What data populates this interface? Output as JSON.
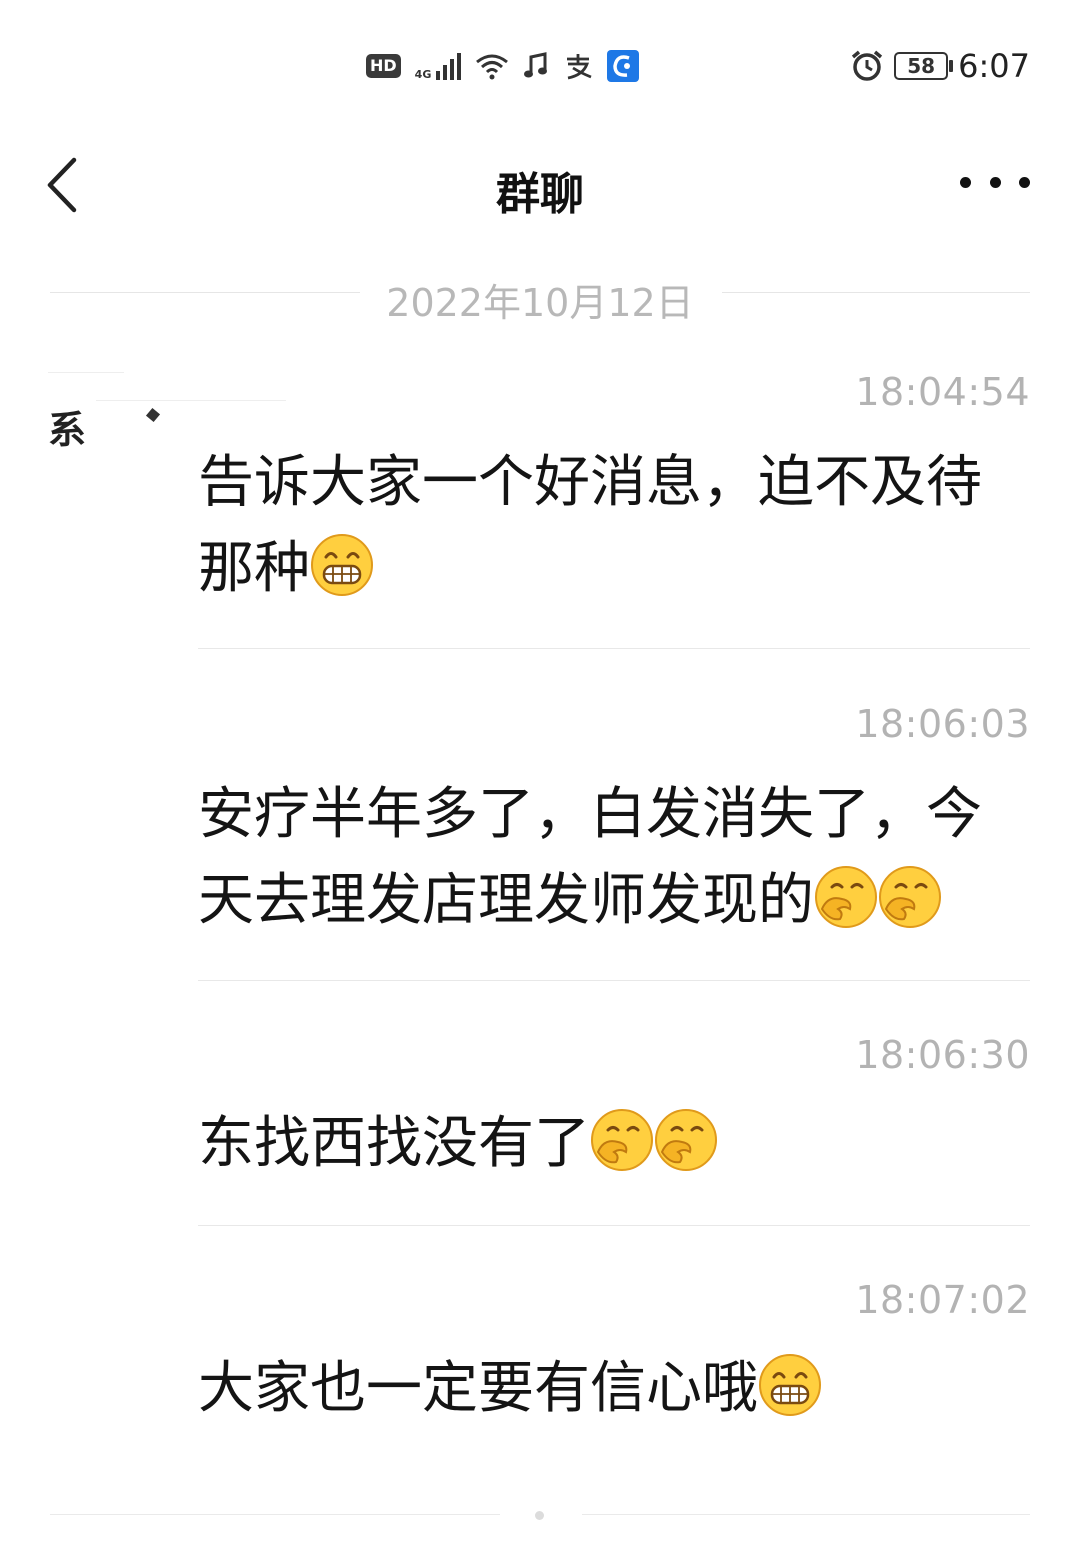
{
  "status_bar": {
    "hd": "HD",
    "network": "4G",
    "time": "6:07",
    "battery": "58",
    "icons": [
      "hd-icon",
      "signal-icon",
      "wifi-icon",
      "music-icon",
      "alipay-icon",
      "browser-icon",
      "alarm-icon",
      "battery-icon"
    ]
  },
  "header": {
    "title": "群聊",
    "back_icon": "chevron-left-icon",
    "more_icon": "more-icon"
  },
  "date_divider": "2022年10月12日",
  "sender": {
    "avatar_glyph": "系"
  },
  "messages": [
    {
      "time": "18:04:54",
      "text": "告诉大家一个好消息，迫不及待那种",
      "emojis": [
        "grin"
      ]
    },
    {
      "time": "18:06:03",
      "text": "安疗半年多了，白发消失了，今天去理发店理发师发现的",
      "emojis": [
        "giggle",
        "giggle"
      ]
    },
    {
      "time": "18:06:30",
      "text": "东找西找没有了",
      "emojis": [
        "giggle",
        "giggle"
      ]
    },
    {
      "time": "18:07:02",
      "text": "大家也一定要有信心哦",
      "emojis": [
        "grin"
      ]
    }
  ],
  "colors": {
    "emoji_yellow": "#FFCF3F",
    "emoji_outline": "#E09A1B",
    "timestamp": "#B3B3B3",
    "divider": "#E8E8E8"
  }
}
